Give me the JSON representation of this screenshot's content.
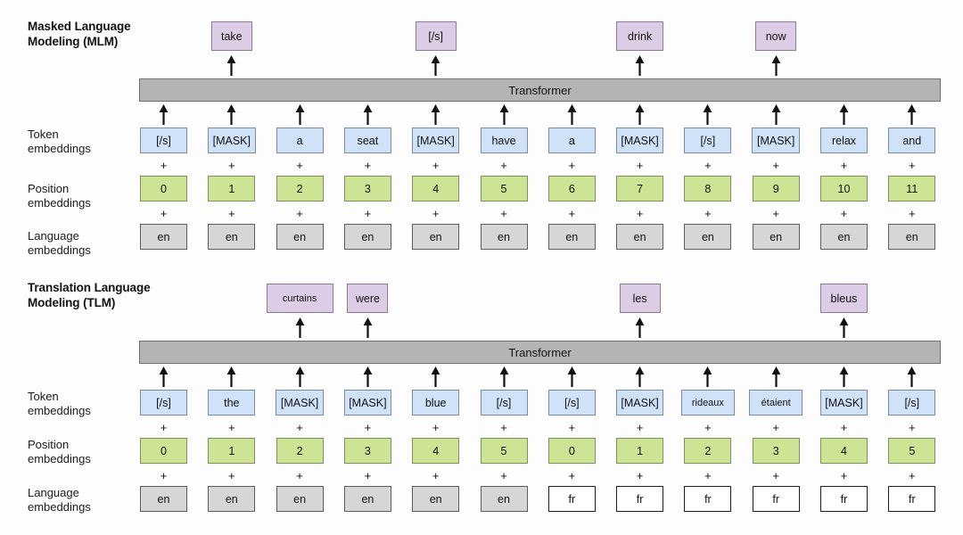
{
  "figure": {
    "type": "diagram",
    "description": "XLM cross-lingual pretraining objectives: Masked Language Modeling and Translation Language Modeling",
    "colors": {
      "output_box": "#ddcce5",
      "token_box": "#cfe2f7",
      "position_box": "#cce494",
      "language_box": "#d6d6d6",
      "language_box_alt": "#ffffff",
      "transformer_bar": "#b4b4b4"
    }
  },
  "row_labels": {
    "token": "Token\nembeddings",
    "position": "Position\nembeddings",
    "language": "Language\nembeddings",
    "plus": "+"
  },
  "mlm": {
    "title": "Masked Language\nModeling (MLM)",
    "transformer_label": "Transformer",
    "outputs": [
      {
        "col": 1,
        "label": "take"
      },
      {
        "col": 4,
        "label": "[/s]"
      },
      {
        "col": 7,
        "label": "drink"
      },
      {
        "col": 9,
        "label": "now"
      }
    ],
    "tokens": [
      "[/s]",
      "[MASK]",
      "a",
      "seat",
      "[MASK]",
      "have",
      "a",
      "[MASK]",
      "[/s]",
      "[MASK]",
      "relax",
      "and"
    ],
    "positions": [
      "0",
      "1",
      "2",
      "3",
      "4",
      "5",
      "6",
      "7",
      "8",
      "9",
      "10",
      "11"
    ],
    "languages": [
      "en",
      "en",
      "en",
      "en",
      "en",
      "en",
      "en",
      "en",
      "en",
      "en",
      "en",
      "en"
    ]
  },
  "tlm": {
    "title": "Translation Language\nModeling (TLM)",
    "transformer_label": "Transformer",
    "outputs": [
      {
        "col": 2,
        "label": "curtains"
      },
      {
        "col": 3,
        "label": "were"
      },
      {
        "col": 7,
        "label": "les"
      },
      {
        "col": 10,
        "label": "bleus"
      }
    ],
    "tokens": [
      "[/s]",
      "the",
      "[MASK]",
      "[MASK]",
      "blue",
      "[/s]",
      "[/s]",
      "[MASK]",
      "rideaux",
      "étaient",
      "[MASK]",
      "[/s]"
    ],
    "positions": [
      "0",
      "1",
      "2",
      "3",
      "4",
      "5",
      "0",
      "1",
      "2",
      "3",
      "4",
      "5"
    ],
    "languages": [
      "en",
      "en",
      "en",
      "en",
      "en",
      "en",
      "fr",
      "fr",
      "fr",
      "fr",
      "fr",
      "fr"
    ]
  }
}
